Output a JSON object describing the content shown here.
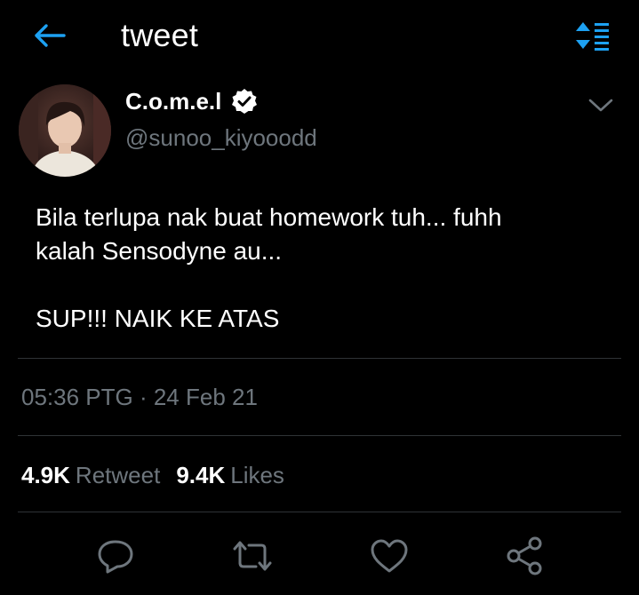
{
  "header": {
    "title": "tweet",
    "back_icon": "arrow-left-icon",
    "sort_icon": "sort-icon"
  },
  "tweet": {
    "display_name": "C.o.m.e.l",
    "verified_icon": "verified-badge-icon",
    "handle": "@sunoo_kiyooodd",
    "text_lines": [
      "Bila terlupa nak buat homework tuh... fuhh",
      "kalah Sensodyne au...",
      "",
      "SUP!!! NAIK KE ATAS"
    ],
    "timestamp": "05:36 PTG · 24 Feb 21",
    "retweet_count": "4.9K",
    "retweet_label": "Retweet",
    "like_count": "9.4K",
    "like_label": "Likes"
  },
  "actions": [
    {
      "icon": "reply-icon"
    },
    {
      "icon": "retweet-icon"
    },
    {
      "icon": "like-icon"
    },
    {
      "icon": "share-icon"
    }
  ],
  "colors": {
    "background": "#000000",
    "accent": "#1da1f2",
    "muted": "#6e767d",
    "divider": "#2f3336",
    "text": "#ffffff"
  }
}
